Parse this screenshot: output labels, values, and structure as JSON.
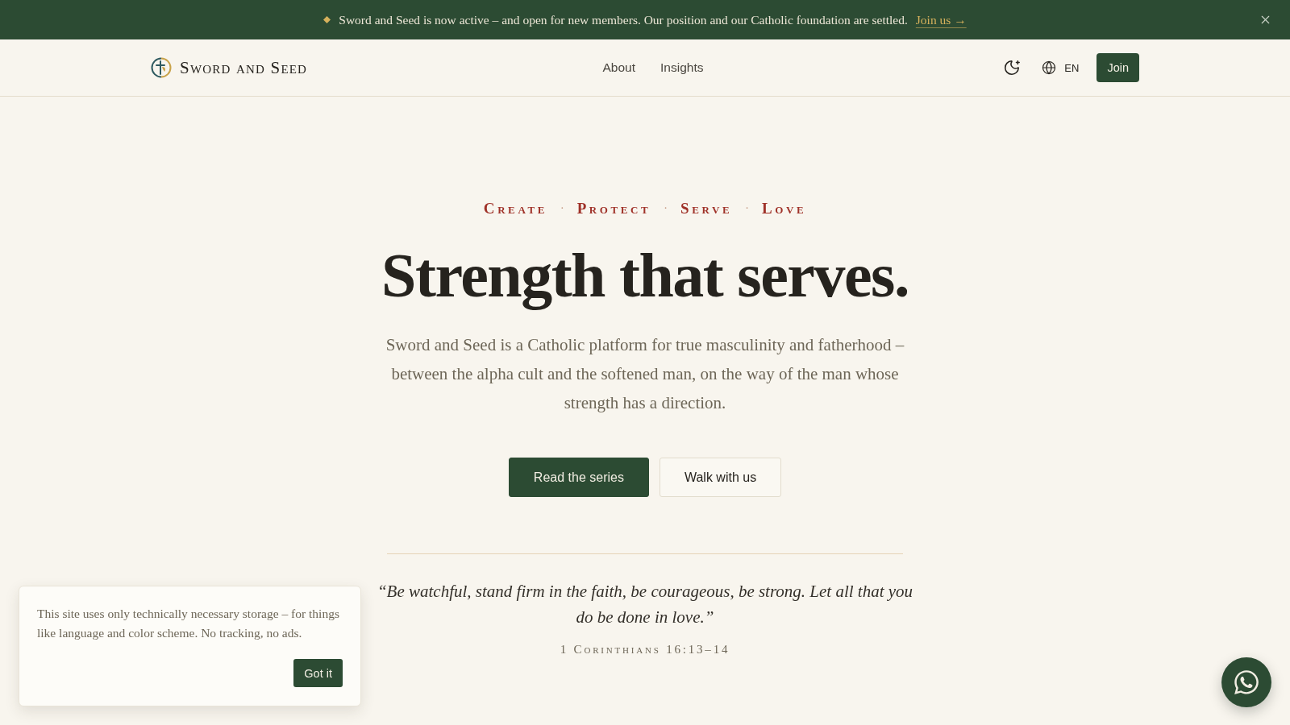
{
  "announcement": {
    "text": "Sword and Seed is now active – and open for new members. Our position and our Catholic foundation are settled.",
    "link": "Join us →"
  },
  "header": {
    "logo": "Sword and Seed",
    "nav": [
      {
        "label": "About"
      },
      {
        "label": "Insights"
      }
    ],
    "language": "EN",
    "join_button": "Join"
  },
  "hero": {
    "virtues": [
      "Create",
      "Protect",
      "Serve",
      "Love"
    ],
    "separator": "·",
    "title": "Strength that serves.",
    "intro": "Sword and Seed is a Catholic platform for true masculinity and fatherhood – between the alpha cult and the softened man, on the way of the man whose strength has a direction.",
    "buttons": [
      {
        "label": "Read the series",
        "kind": "primary"
      },
      {
        "label": "Walk with us",
        "kind": "secondary"
      }
    ]
  },
  "quote": {
    "text": "“Be watchful, stand firm in the faith, be courageous, be strong. Let all that you do be done in love.”",
    "citation": "1 Corinthians 16:13–14"
  },
  "cookie_notice": {
    "text": "This site uses only technically necessary storage – for things like language and color scheme. No tracking, no ads.",
    "button": "Got it"
  }
}
